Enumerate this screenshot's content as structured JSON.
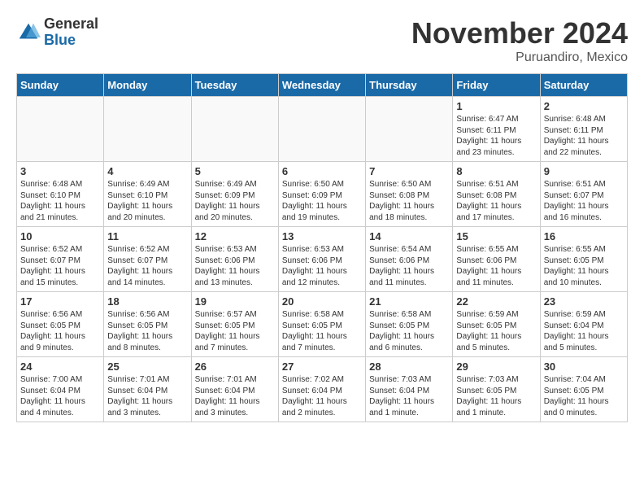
{
  "header": {
    "logo_general": "General",
    "logo_blue": "Blue",
    "month_title": "November 2024",
    "location": "Puruandiro, Mexico"
  },
  "calendar": {
    "days_of_week": [
      "Sunday",
      "Monday",
      "Tuesday",
      "Wednesday",
      "Thursday",
      "Friday",
      "Saturday"
    ],
    "weeks": [
      [
        {
          "day": "",
          "info": ""
        },
        {
          "day": "",
          "info": ""
        },
        {
          "day": "",
          "info": ""
        },
        {
          "day": "",
          "info": ""
        },
        {
          "day": "",
          "info": ""
        },
        {
          "day": "1",
          "info": "Sunrise: 6:47 AM\nSunset: 6:11 PM\nDaylight: 11 hours and 23 minutes."
        },
        {
          "day": "2",
          "info": "Sunrise: 6:48 AM\nSunset: 6:11 PM\nDaylight: 11 hours and 22 minutes."
        }
      ],
      [
        {
          "day": "3",
          "info": "Sunrise: 6:48 AM\nSunset: 6:10 PM\nDaylight: 11 hours and 21 minutes."
        },
        {
          "day": "4",
          "info": "Sunrise: 6:49 AM\nSunset: 6:10 PM\nDaylight: 11 hours and 20 minutes."
        },
        {
          "day": "5",
          "info": "Sunrise: 6:49 AM\nSunset: 6:09 PM\nDaylight: 11 hours and 20 minutes."
        },
        {
          "day": "6",
          "info": "Sunrise: 6:50 AM\nSunset: 6:09 PM\nDaylight: 11 hours and 19 minutes."
        },
        {
          "day": "7",
          "info": "Sunrise: 6:50 AM\nSunset: 6:08 PM\nDaylight: 11 hours and 18 minutes."
        },
        {
          "day": "8",
          "info": "Sunrise: 6:51 AM\nSunset: 6:08 PM\nDaylight: 11 hours and 17 minutes."
        },
        {
          "day": "9",
          "info": "Sunrise: 6:51 AM\nSunset: 6:07 PM\nDaylight: 11 hours and 16 minutes."
        }
      ],
      [
        {
          "day": "10",
          "info": "Sunrise: 6:52 AM\nSunset: 6:07 PM\nDaylight: 11 hours and 15 minutes."
        },
        {
          "day": "11",
          "info": "Sunrise: 6:52 AM\nSunset: 6:07 PM\nDaylight: 11 hours and 14 minutes."
        },
        {
          "day": "12",
          "info": "Sunrise: 6:53 AM\nSunset: 6:06 PM\nDaylight: 11 hours and 13 minutes."
        },
        {
          "day": "13",
          "info": "Sunrise: 6:53 AM\nSunset: 6:06 PM\nDaylight: 11 hours and 12 minutes."
        },
        {
          "day": "14",
          "info": "Sunrise: 6:54 AM\nSunset: 6:06 PM\nDaylight: 11 hours and 11 minutes."
        },
        {
          "day": "15",
          "info": "Sunrise: 6:55 AM\nSunset: 6:06 PM\nDaylight: 11 hours and 11 minutes."
        },
        {
          "day": "16",
          "info": "Sunrise: 6:55 AM\nSunset: 6:05 PM\nDaylight: 11 hours and 10 minutes."
        }
      ],
      [
        {
          "day": "17",
          "info": "Sunrise: 6:56 AM\nSunset: 6:05 PM\nDaylight: 11 hours and 9 minutes."
        },
        {
          "day": "18",
          "info": "Sunrise: 6:56 AM\nSunset: 6:05 PM\nDaylight: 11 hours and 8 minutes."
        },
        {
          "day": "19",
          "info": "Sunrise: 6:57 AM\nSunset: 6:05 PM\nDaylight: 11 hours and 7 minutes."
        },
        {
          "day": "20",
          "info": "Sunrise: 6:58 AM\nSunset: 6:05 PM\nDaylight: 11 hours and 7 minutes."
        },
        {
          "day": "21",
          "info": "Sunrise: 6:58 AM\nSunset: 6:05 PM\nDaylight: 11 hours and 6 minutes."
        },
        {
          "day": "22",
          "info": "Sunrise: 6:59 AM\nSunset: 6:05 PM\nDaylight: 11 hours and 5 minutes."
        },
        {
          "day": "23",
          "info": "Sunrise: 6:59 AM\nSunset: 6:04 PM\nDaylight: 11 hours and 5 minutes."
        }
      ],
      [
        {
          "day": "24",
          "info": "Sunrise: 7:00 AM\nSunset: 6:04 PM\nDaylight: 11 hours and 4 minutes."
        },
        {
          "day": "25",
          "info": "Sunrise: 7:01 AM\nSunset: 6:04 PM\nDaylight: 11 hours and 3 minutes."
        },
        {
          "day": "26",
          "info": "Sunrise: 7:01 AM\nSunset: 6:04 PM\nDaylight: 11 hours and 3 minutes."
        },
        {
          "day": "27",
          "info": "Sunrise: 7:02 AM\nSunset: 6:04 PM\nDaylight: 11 hours and 2 minutes."
        },
        {
          "day": "28",
          "info": "Sunrise: 7:03 AM\nSunset: 6:04 PM\nDaylight: 11 hours and 1 minute."
        },
        {
          "day": "29",
          "info": "Sunrise: 7:03 AM\nSunset: 6:05 PM\nDaylight: 11 hours and 1 minute."
        },
        {
          "day": "30",
          "info": "Sunrise: 7:04 AM\nSunset: 6:05 PM\nDaylight: 11 hours and 0 minutes."
        }
      ]
    ]
  }
}
